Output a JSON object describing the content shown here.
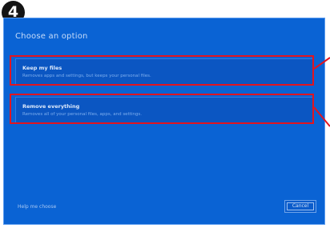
{
  "step_badge": "4",
  "dialog": {
    "title": "Choose an option",
    "options": [
      {
        "title": "Keep my files",
        "description": "Removes apps and settings, but keeps your personal files."
      },
      {
        "title": "Remove everything",
        "description": "Removes all of your personal files, apps, and settings."
      }
    ],
    "help_link": "Help me choose",
    "cancel_label": "Cancel"
  },
  "colors": {
    "dialog_background": "#0a63d4",
    "highlight": "#e21520",
    "badge": "#141414"
  }
}
